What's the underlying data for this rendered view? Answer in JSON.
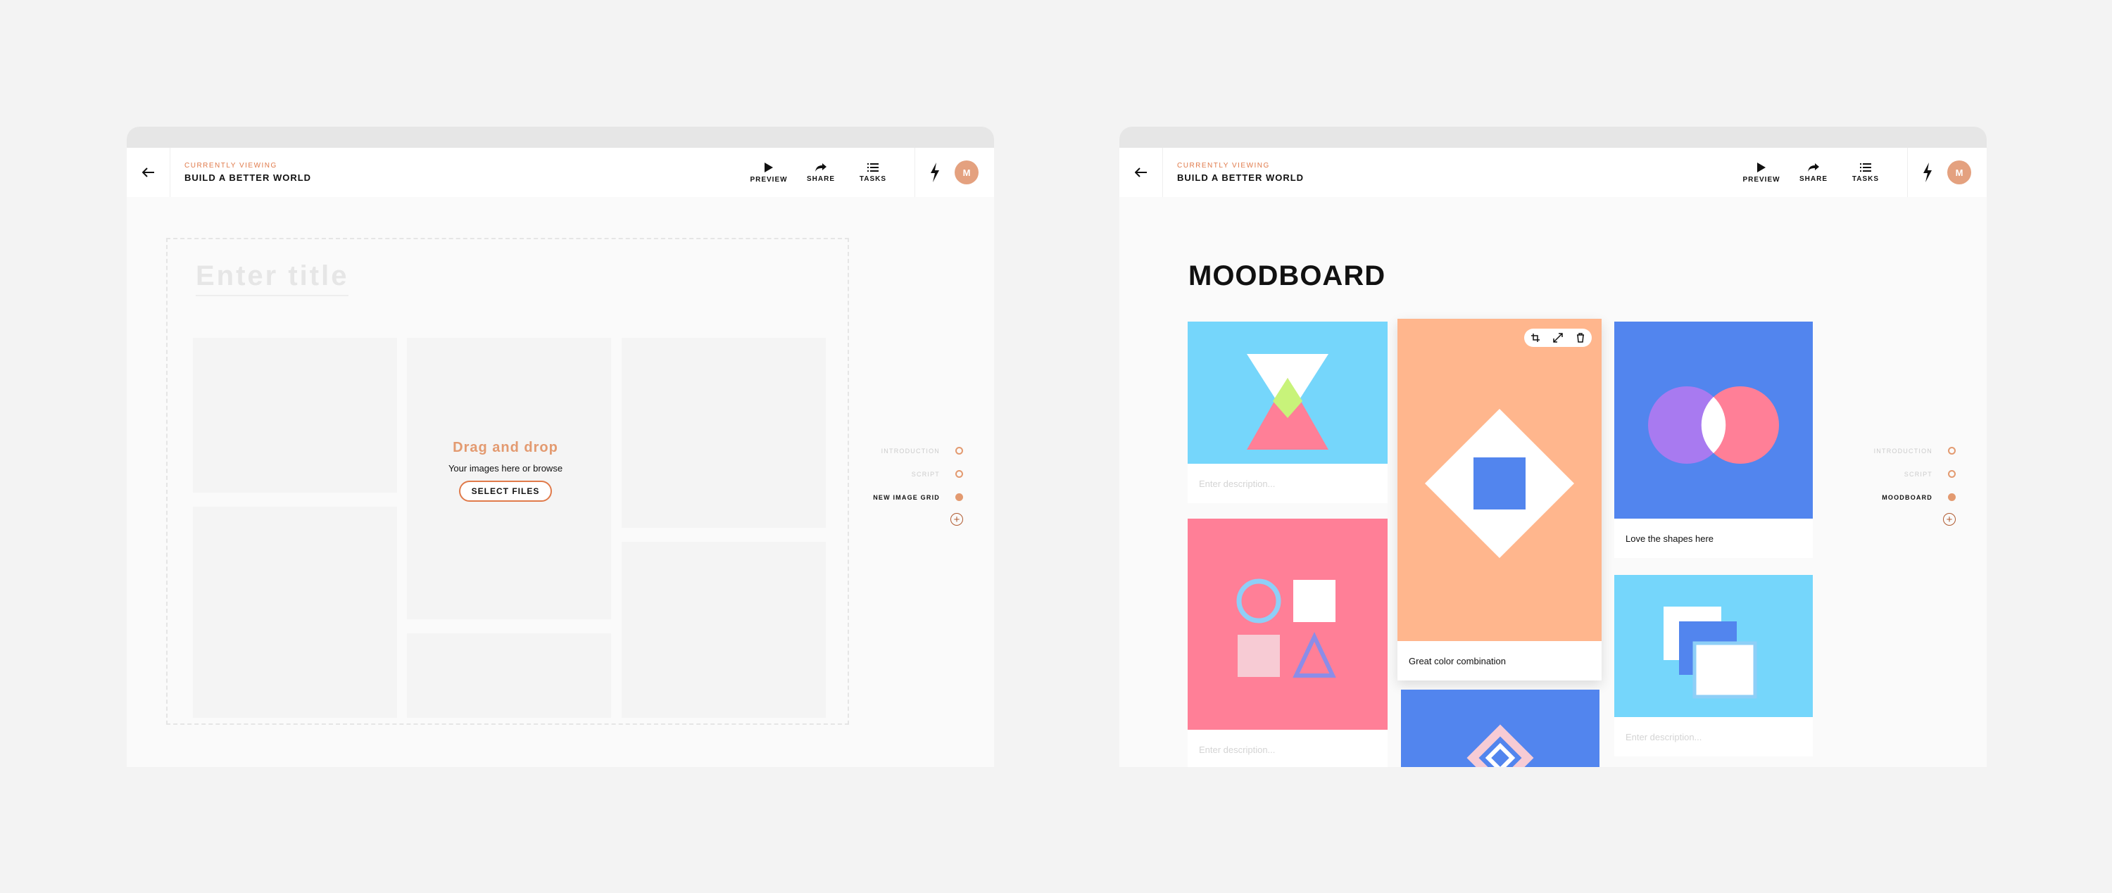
{
  "header": {
    "currently_viewing": "CURRENTLY VIEWING",
    "project_title": "BUILD A BETTER WORLD",
    "preview": "PREVIEW",
    "share": "SHARE",
    "tasks": "TASKS",
    "avatar_initial": "M"
  },
  "left": {
    "title_placeholder": "Enter title",
    "drag_title": "Drag and drop",
    "drag_sub": "Your images here or browse",
    "select_files": "SELECT FILES",
    "nav": [
      "INTRODUCTION",
      "SCRIPT",
      "NEW IMAGE GRID"
    ]
  },
  "right": {
    "title": "MOODBOARD",
    "nav": [
      "INTRODUCTION",
      "SCRIPT",
      "MOODBOARD"
    ],
    "descriptions": {
      "card1": "Enter description...",
      "card2": "Great color combination",
      "card3": "Love the shapes here",
      "card4": "Enter description...",
      "card6": "Enter description..."
    }
  },
  "colors": {
    "accent": "#e07a4a",
    "sky": "#75d6fb",
    "peach": "#ffb68d",
    "blue": "#5285ee",
    "pink": "#ff7f97"
  }
}
